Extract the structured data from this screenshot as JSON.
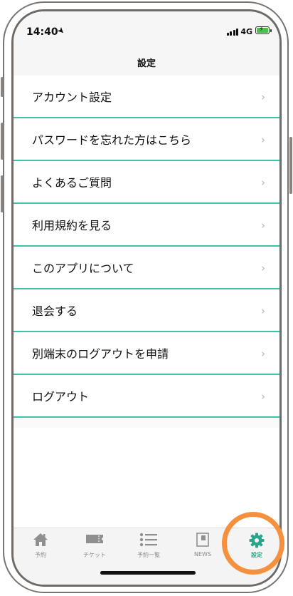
{
  "status_bar": {
    "time": "14:40",
    "network": "4G"
  },
  "nav": {
    "title": "設定"
  },
  "menu": {
    "items": [
      {
        "label": "アカウント設定"
      },
      {
        "label": "パスワードを忘れた方はこちら"
      },
      {
        "label": "よくあるご質問"
      },
      {
        "label": "利用規約を見る"
      },
      {
        "label": "このアプリについて"
      },
      {
        "label": "退会する"
      },
      {
        "label": "別端末のログアウトを申請"
      },
      {
        "label": "ログアウト"
      }
    ],
    "chevron": "›"
  },
  "tab_bar": {
    "tabs": [
      {
        "label": "予約",
        "icon": "home-icon"
      },
      {
        "label": "チケット",
        "icon": "ticket-icon"
      },
      {
        "label": "予約一覧",
        "icon": "list-icon"
      },
      {
        "label": "NEWS",
        "icon": "news-icon"
      },
      {
        "label": "設定",
        "icon": "gear-icon",
        "active": true
      }
    ]
  },
  "colors": {
    "accent": "#3cc4a4",
    "active_tab": "#2aa58a",
    "highlight": "#f5913e",
    "inactive_icon": "#8f8f8f"
  }
}
